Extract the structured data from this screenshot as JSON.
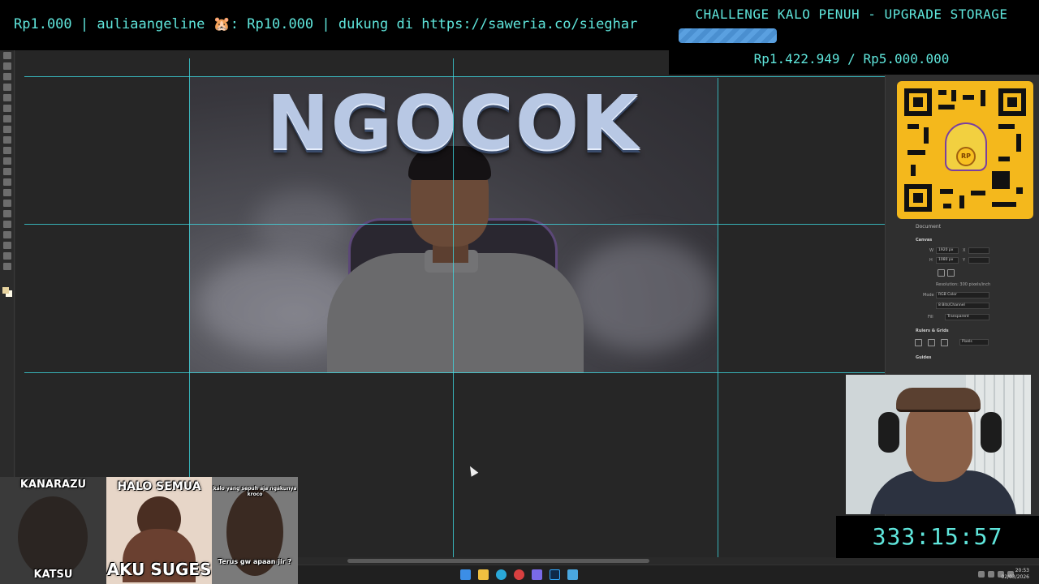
{
  "donation_ticker": {
    "text": "Rp1.000 | auliaangeline 🐹: Rp10.000 |  dukung di https://saweria.co/sieghar"
  },
  "challenge": {
    "title": "CHALLENGE KALO PENUH - UPGRADE STORAGE",
    "amount": "Rp1.422.949 / Rp5.000.000",
    "progress": 0.2846
  },
  "thumbnail": {
    "title": "NGOCOK"
  },
  "properties_panel": {
    "tab": "Document",
    "canvas_section": "Canvas",
    "width_label": "W",
    "width_value": "1920 px",
    "height_label": "H",
    "height_value": "1080 px",
    "x_label": "X",
    "y_label": "Y",
    "resolution": "Resolution: 300 pixels/inch",
    "mode_label": "Mode",
    "mode_value": "RGB Color",
    "bits_value": "8 Bits/Channel",
    "fill_label": "Fill",
    "fill_value": "Transparent",
    "rulers_section": "Rulers & Grids",
    "units_value": "Pixels",
    "guides_section": "Guides"
  },
  "qr": {
    "coin_label": "RP"
  },
  "timer": {
    "value": "333:15:57"
  },
  "memes": [
    {
      "top": "KANARAZU",
      "bottom": "KATSU"
    },
    {
      "top": "HALO SEMUA",
      "bottom": "AKU SUGES"
    },
    {
      "top": "kalo yang sepuh aja ngakunya kroco",
      "bottom": "Terus gw apaan jir ?"
    }
  ],
  "taskbar": {
    "time": "20:53",
    "date": "02/03/2026"
  },
  "colors": {
    "overlay_text": "#5fe6dc",
    "guide": "#3ee0e8",
    "progress_fill": "#4a8fd0",
    "qr_frame": "#f4b81c"
  }
}
